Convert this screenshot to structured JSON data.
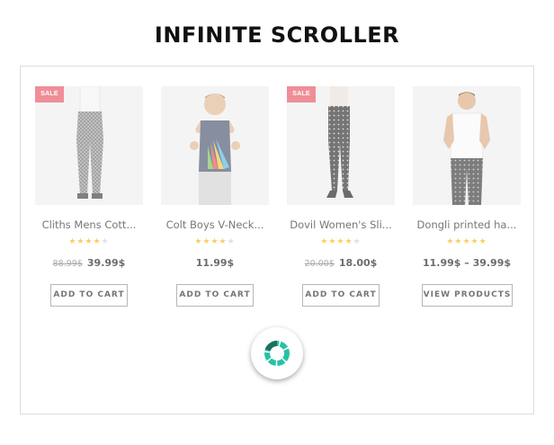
{
  "header": {
    "title": "INFINITE SCROLLER"
  },
  "products": [
    {
      "name": "Cliths Mens Cott...",
      "sale_badge": "SALE",
      "rating": 4,
      "old_price": "88.99$",
      "price": "39.99$",
      "button_label": "ADD TO CART",
      "image": "man-checked-trousers"
    },
    {
      "name": "Colt Boys V-Neck...",
      "sale_badge": "",
      "rating": 4,
      "old_price": "",
      "price": "11.99$",
      "button_label": "ADD TO CART",
      "image": "boy-tank-top"
    },
    {
      "name": "Dovil Women's Sli...",
      "sale_badge": "SALE",
      "rating": 4,
      "old_price": "20.00$",
      "price": "18.00$",
      "button_label": "ADD TO CART",
      "image": "woman-dotted-trousers"
    },
    {
      "name": "Dongli printed ha...",
      "sale_badge": "",
      "rating": 5,
      "old_price": "",
      "price": "11.99$ – 39.99$",
      "button_label": "VIEW PRODUCTS",
      "image": "man-white-tank"
    }
  ],
  "loader": {
    "icon": "loading-spinner-icon",
    "color": "#27c2a5"
  },
  "colors": {
    "sale": "#e64a5c",
    "star": "#f5b400"
  }
}
